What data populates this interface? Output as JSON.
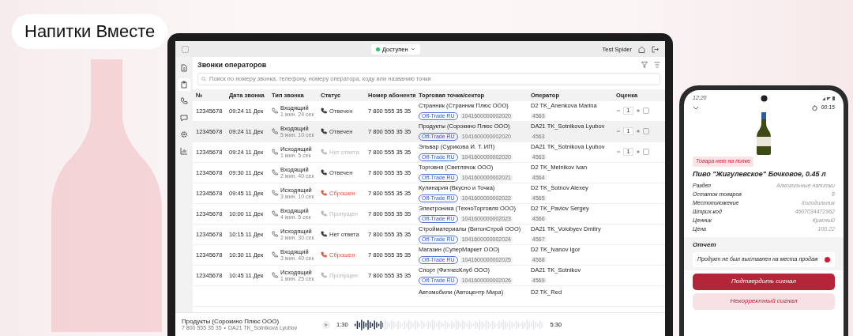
{
  "brand": {
    "title": "Напитки Вместе"
  },
  "app": {
    "status": {
      "label": "Доступен",
      "color": "#22c55e"
    },
    "user": "Test Spider",
    "sidebar": [
      {
        "selected": false
      },
      {
        "selected": true
      },
      {
        "selected": false
      },
      {
        "selected": false
      },
      {
        "selected": false
      },
      {
        "selected": false
      }
    ],
    "page_title": "Звонки операторов",
    "search": {
      "placeholder": "Поиск по номеру звонка, телефону, номеру оператора, коду или названию точки"
    },
    "table": {
      "columns": [
        "№",
        "Дата звонка",
        "Тип звонка",
        "Статус",
        "Номер абонента",
        "Торговая точка/сектор",
        "Оператор",
        "Оценка"
      ],
      "rows": [
        {
          "kind": "full",
          "selected": false,
          "id": "12345678",
          "date": "09:24 11 Дек",
          "call_type": "Входящий",
          "duration": "1 мин. 24 сек",
          "status": {
            "label": "Отвечен",
            "color": "#333333"
          },
          "phone": "7 800 555 35 35",
          "outlet": "Странник (Странник Плюс ООО)",
          "tag": "Off-Trade RU",
          "code": "1041600000002020",
          "operator": "D2 TK_Anenkova Marina",
          "op_code": "4563",
          "rating": "1"
        },
        {
          "kind": "full",
          "selected": true,
          "id": "12345678",
          "date": "09:24 11 Дек",
          "call_type": "Входящий",
          "duration": "5 мин. 10 сек",
          "status": {
            "label": "Отвечен",
            "color": "#333333"
          },
          "phone": "7 800 555 35 35",
          "outlet": "Продукты (Сорокино Плюс ООО)",
          "tag": "Off-Trade RU",
          "code": "1041600000002020",
          "operator": "DA21 TK_Sotnikova Lyubov",
          "op_code": "4563",
          "rating": "1"
        },
        {
          "kind": "full",
          "selected": false,
          "id": "12345678",
          "date": "09:24 11 Дек",
          "call_type": "Исходящий",
          "duration": "1 мин. 5 сек",
          "status": {
            "label": "Нет ответа",
            "color": "#b8b8b8"
          },
          "phone": "7 800 555 35 35",
          "outlet": "Эльвар (Сурикова И. Т. ИП)",
          "tag": "Off-Trade RU",
          "code": "1041600000002020",
          "operator": "DA21 TK_Sotnikova Lyubov",
          "op_code": "4563",
          "rating": "1"
        },
        {
          "kind": "full",
          "selected": false,
          "id": "12345678",
          "date": "09:30 11 Дек",
          "call_type": "Входящий",
          "duration": "2 мин. 40 сек",
          "status": {
            "label": "Отвечен",
            "color": "#333333"
          },
          "phone": "7 800 555 35 35",
          "outlet": "Торговня (Светлячок ООО)",
          "tag": "Off-Trade RU",
          "code": "1041600000002021",
          "operator": "D2 TK_Melnikov Ivan",
          "op_code": "4564"
        },
        {
          "kind": "full",
          "selected": false,
          "id": "12345678",
          "date": "09:45 11 Дек",
          "call_type": "Исходящий",
          "duration": "3 мин. 10 сек",
          "status": {
            "label": "Сброшен",
            "color": "#e0533a"
          },
          "phone": "7 800 555 35 35",
          "outlet": "Кулинария (Вкусно и Точка)",
          "tag": "Off-Trade RU",
          "code": "1041600000002022",
          "operator": "D2 TK_Sotnov Alexey",
          "op_code": "4565"
        },
        {
          "kind": "full",
          "selected": false,
          "id": "12345678",
          "date": "10:00 11 Дек",
          "call_type": "Входящий",
          "duration": "4 мин. 5 сек",
          "status": {
            "label": "Пропущен",
            "color": "#b8b8b8"
          },
          "phone": "7 800 555 35 35",
          "outlet": "Электроника (ТехноТорговля ООО)",
          "tag": "Off-Trade RU",
          "code": "1041600000002023",
          "operator": "D2 TK_Pavlov Sergey",
          "op_code": "4566"
        },
        {
          "kind": "full",
          "selected": false,
          "id": "12345678",
          "date": "10:15 11 Дек",
          "call_type": "Исходящий",
          "duration": "2 мин. 30 сек",
          "status": {
            "label": "Нет ответа",
            "color": "#333333"
          },
          "phone": "7 800 555 35 35",
          "outlet": "Стройматериалы (ВитонСтрой ООО)",
          "tag": "Off-Trade RU",
          "code": "1041600000002024",
          "operator": "DA21 TK_Volobyev Dmitry",
          "op_code": "4567"
        },
        {
          "kind": "full",
          "selected": false,
          "id": "12345678",
          "date": "10:30 11 Дек",
          "call_type": "Входящий",
          "duration": "3 мин. 40 сек",
          "status": {
            "label": "Сброшен",
            "color": "#e0533a"
          },
          "phone": "7 800 555 35 35",
          "outlet": "Магазин (СуперМаркет ООО)",
          "tag": "Off-Trade RU",
          "code": "1041600000002025",
          "operator": "D2 TK_Ivanov Igor",
          "op_code": "4568"
        },
        {
          "kind": "full",
          "selected": false,
          "id": "12345678",
          "date": "10:45 11 Дек",
          "call_type": "Исходящий",
          "duration": "1 мин. 25 сек",
          "status": {
            "label": "Пропущен",
            "color": "#b8b8b8"
          },
          "phone": "7 800 555 35 35",
          "outlet": "Спорт (ФитнесКлуб ООО)",
          "tag": "Off-Trade RU",
          "code": "1041600000002026",
          "operator": "DA21 TK_Sotnikov",
          "op_code": "4569"
        },
        {
          "kind": "partial",
          "selected": false,
          "outlet": "Автомобили (Автоцентр Мира)",
          "operator": "D2 TK_Red"
        }
      ]
    },
    "player": {
      "title": "Продукты (Сорокино Плюс ООО)",
      "phone": "7 800 555 35 35",
      "separator": "•",
      "operator": "DA21 TK_Sotnikova Lyubov",
      "current": "1:30",
      "total": "5:30",
      "level": 0.15
    }
  },
  "phone": {
    "time": "12:20",
    "timer": "00:15",
    "tag": "Товара нет на полке",
    "product": "Пиво \"Жигулевское\" Бочковое, 0.45 л",
    "props": [
      {
        "label": "Раздел",
        "value": "Алкогольные напитки"
      },
      {
        "label": "Остаток товаров",
        "value": "8"
      },
      {
        "label": "Местоположение",
        "value": "Холодильник"
      },
      {
        "label": "Штрих-код",
        "value": "4607034472962"
      },
      {
        "label": "Ценник",
        "value": "Красный"
      },
      {
        "label": "Цена",
        "value": "100.22"
      }
    ],
    "report_title": "Отчет",
    "report_items": [
      {
        "label": "Продукт не был выставлен на места продаж",
        "checked": true
      }
    ],
    "buttons": [
      {
        "label": "Подтвердить сигнал",
        "kind": "primary"
      },
      {
        "label": "Некорректный сигнал",
        "kind": "secondary"
      }
    ]
  }
}
